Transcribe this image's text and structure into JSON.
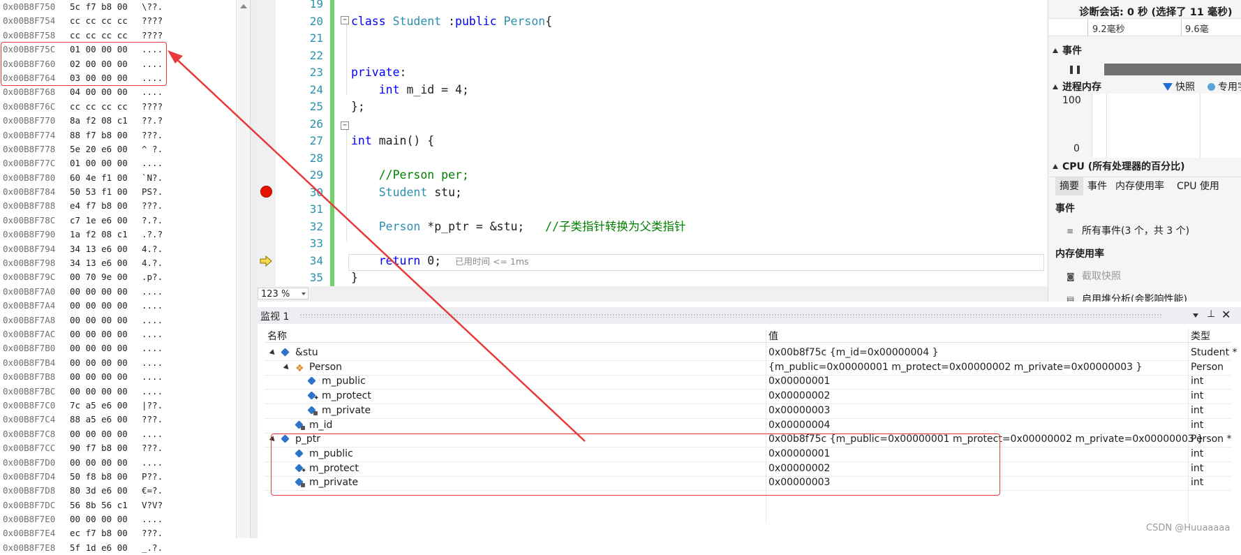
{
  "memory": {
    "rows": [
      {
        "addr": "0x00B8F750",
        "bytes": "5c f7 b8 00",
        "ascii": "\\??."
      },
      {
        "addr": "0x00B8F754",
        "bytes": "cc cc cc cc",
        "ascii": "????"
      },
      {
        "addr": "0x00B8F758",
        "bytes": "cc cc cc cc",
        "ascii": "????"
      },
      {
        "addr": "0x00B8F75C",
        "bytes": "01 00 00 00",
        "ascii": "...."
      },
      {
        "addr": "0x00B8F760",
        "bytes": "02 00 00 00",
        "ascii": "...."
      },
      {
        "addr": "0x00B8F764",
        "bytes": "03 00 00 00",
        "ascii": "...."
      },
      {
        "addr": "0x00B8F768",
        "bytes": "04 00 00 00",
        "ascii": "...."
      },
      {
        "addr": "0x00B8F76C",
        "bytes": "cc cc cc cc",
        "ascii": "????"
      },
      {
        "addr": "0x00B8F770",
        "bytes": "8a f2 08 c1",
        "ascii": "??.?"
      },
      {
        "addr": "0x00B8F774",
        "bytes": "88 f7 b8 00",
        "ascii": "???."
      },
      {
        "addr": "0x00B8F778",
        "bytes": "5e 20 e6 00",
        "ascii": "^ ?."
      },
      {
        "addr": "0x00B8F77C",
        "bytes": "01 00 00 00",
        "ascii": "...."
      },
      {
        "addr": "0x00B8F780",
        "bytes": "60 4e f1 00",
        "ascii": "`N?."
      },
      {
        "addr": "0x00B8F784",
        "bytes": "50 53 f1 00",
        "ascii": "PS?."
      },
      {
        "addr": "0x00B8F788",
        "bytes": "e4 f7 b8 00",
        "ascii": "???."
      },
      {
        "addr": "0x00B8F78C",
        "bytes": "c7 1e e6 00",
        "ascii": "?.?."
      },
      {
        "addr": "0x00B8F790",
        "bytes": "1a f2 08 c1",
        "ascii": ".?.?"
      },
      {
        "addr": "0x00B8F794",
        "bytes": "34 13 e6 00",
        "ascii": "4.?."
      },
      {
        "addr": "0x00B8F798",
        "bytes": "34 13 e6 00",
        "ascii": "4.?."
      },
      {
        "addr": "0x00B8F79C",
        "bytes": "00 70 9e 00",
        "ascii": ".p?."
      },
      {
        "addr": "0x00B8F7A0",
        "bytes": "00 00 00 00",
        "ascii": "...."
      },
      {
        "addr": "0x00B8F7A4",
        "bytes": "00 00 00 00",
        "ascii": "...."
      },
      {
        "addr": "0x00B8F7A8",
        "bytes": "00 00 00 00",
        "ascii": "...."
      },
      {
        "addr": "0x00B8F7AC",
        "bytes": "00 00 00 00",
        "ascii": "...."
      },
      {
        "addr": "0x00B8F7B0",
        "bytes": "00 00 00 00",
        "ascii": "...."
      },
      {
        "addr": "0x00B8F7B4",
        "bytes": "00 00 00 00",
        "ascii": "...."
      },
      {
        "addr": "0x00B8F7B8",
        "bytes": "00 00 00 00",
        "ascii": "...."
      },
      {
        "addr": "0x00B8F7BC",
        "bytes": "00 00 00 00",
        "ascii": "...."
      },
      {
        "addr": "0x00B8F7C0",
        "bytes": "7c a5 e6 00",
        "ascii": "|??."
      },
      {
        "addr": "0x00B8F7C4",
        "bytes": "88 a5 e6 00",
        "ascii": "???."
      },
      {
        "addr": "0x00B8F7C8",
        "bytes": "00 00 00 00",
        "ascii": "...."
      },
      {
        "addr": "0x00B8F7CC",
        "bytes": "90 f7 b8 00",
        "ascii": "???."
      },
      {
        "addr": "0x00B8F7D0",
        "bytes": "00 00 00 00",
        "ascii": "...."
      },
      {
        "addr": "0x00B8F7D4",
        "bytes": "50 f8 b8 00",
        "ascii": "P??."
      },
      {
        "addr": "0x00B8F7D8",
        "bytes": "80 3d e6 00",
        "ascii": "€=?."
      },
      {
        "addr": "0x00B8F7DC",
        "bytes": "56 8b 56 c1",
        "ascii": "V?V?"
      },
      {
        "addr": "0x00B8F7E0",
        "bytes": "00 00 00 00",
        "ascii": "...."
      },
      {
        "addr": "0x00B8F7E4",
        "bytes": "ec f7 b8 00",
        "ascii": "???."
      },
      {
        "addr": "0x00B8F7E8",
        "bytes": "5f 1d e6 00",
        "ascii": "_.?."
      }
    ]
  },
  "editor": {
    "line_numbers": [
      "19",
      "20",
      "21",
      "22",
      "23",
      "24",
      "25",
      "26",
      "27",
      "28",
      "29",
      "30",
      "31",
      "32",
      "33",
      "34",
      "35"
    ],
    "code": [
      [],
      [
        {
          "t": "class ",
          "c": "kw"
        },
        {
          "t": "Student",
          "c": "ty"
        },
        {
          "t": " :",
          "c": "tx"
        },
        {
          "t": "public ",
          "c": "kw"
        },
        {
          "t": "Person",
          "c": "ty"
        },
        {
          "t": "{",
          "c": "tx"
        }
      ],
      [],
      [],
      [
        {
          "t": "private",
          "c": "kw"
        },
        {
          "t": ":",
          "c": "tx"
        }
      ],
      [
        {
          "t": "    ",
          "c": "tx"
        },
        {
          "t": "int",
          "c": "kw"
        },
        {
          "t": " m_id = 4;",
          "c": "tx"
        }
      ],
      [
        {
          "t": "};",
          "c": "tx"
        }
      ],
      [],
      [
        {
          "t": "int",
          "c": "kw"
        },
        {
          "t": " main() {",
          "c": "tx"
        }
      ],
      [],
      [
        {
          "t": "    ",
          "c": "tx"
        },
        {
          "t": "//Person per;",
          "c": "cm"
        }
      ],
      [
        {
          "t": "    ",
          "c": "tx"
        },
        {
          "t": "Student",
          "c": "ty"
        },
        {
          "t": " stu;",
          "c": "tx"
        }
      ],
      [],
      [
        {
          "t": "    ",
          "c": "tx"
        },
        {
          "t": "Person",
          "c": "ty"
        },
        {
          "t": " *p_ptr = &stu;   ",
          "c": "tx"
        },
        {
          "t": "//子类指针转换为父类指针",
          "c": "cm"
        }
      ],
      [],
      [
        {
          "t": "    ",
          "c": "tx"
        },
        {
          "t": "return",
          "c": "kw"
        },
        {
          "t": " 0;  ",
          "c": "tx"
        },
        {
          "t": "已用时间 <= 1ms",
          "c": "hint"
        }
      ],
      [
        {
          "t": "}",
          "c": "tx"
        }
      ]
    ],
    "zoom": "123 %"
  },
  "diagnostics": {
    "session": "诊断会话: 0 秒 (选择了 11 毫秒)",
    "ruler": [
      "9.2毫秒",
      "9.6毫"
    ],
    "events_header": "事件",
    "memory_header": "进程内存",
    "legend_snapshot": "快照",
    "legend_private": "专用字",
    "y_max": "100",
    "y_min": "0",
    "cpu_header": "CPU (所有处理器的百分比)",
    "tabs": [
      "摘要",
      "事件",
      "内存使用率",
      "CPU 使用"
    ],
    "section_events": "事件",
    "all_events": "所有事件(3 个，共 3 个)",
    "section_memory": "内存使用率",
    "take_snapshot": "截取快照",
    "heap_analysis": "启用堆分析(会影响性能)"
  },
  "watch": {
    "title": "监视 1",
    "columns": {
      "name": "名称",
      "value": "值",
      "type": "类型"
    },
    "rows": [
      {
        "name": "&stu",
        "value": "0x00b8f75c {m_id=0x00000004 }",
        "type": "Student *"
      },
      {
        "name": "Person",
        "value": "{m_public=0x00000001 m_protect=0x00000002 m_private=0x00000003 }",
        "type": "Person"
      },
      {
        "name": "m_public",
        "value": "0x00000001",
        "type": "int"
      },
      {
        "name": "m_protect",
        "value": "0x00000002",
        "type": "int"
      },
      {
        "name": "m_private",
        "value": "0x00000003",
        "type": "int"
      },
      {
        "name": "m_id",
        "value": "0x00000004",
        "type": "int"
      },
      {
        "name": "p_ptr",
        "value": "0x00b8f75c {m_public=0x00000001 m_protect=0x00000002 m_private=0x00000003 }",
        "type": "Person *"
      },
      {
        "name": "m_public",
        "value": "0x00000001",
        "type": "int"
      },
      {
        "name": "m_protect",
        "value": "0x00000002",
        "type": "int"
      },
      {
        "name": "m_private",
        "value": "0x00000003",
        "type": "int"
      }
    ]
  },
  "watermark": "CSDN @Huuaaaaa",
  "colors": {
    "annotation": "#e83a3a",
    "breakpoint": "#e51400",
    "change_bar": "#6fd36a"
  }
}
